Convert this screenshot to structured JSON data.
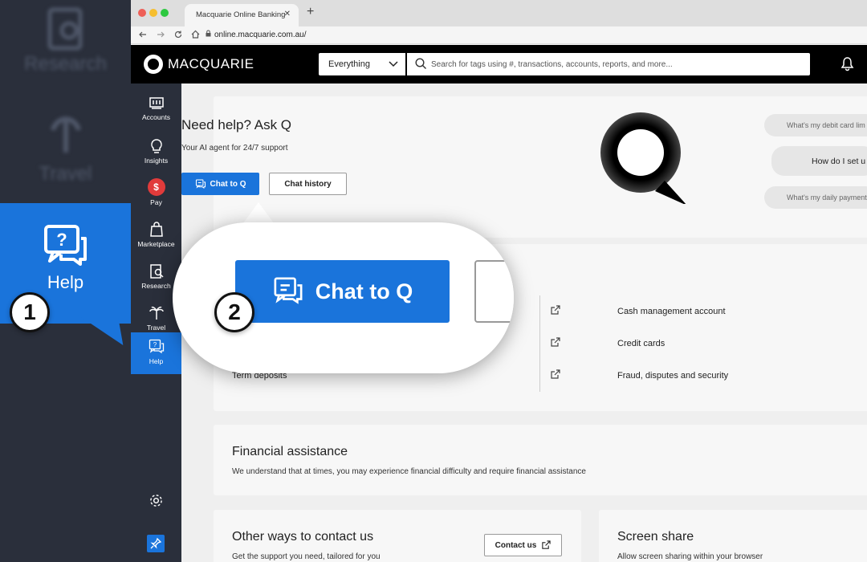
{
  "zoom": {
    "ghost_research": "Research",
    "ghost_travel": "Travel",
    "help_label": "Help",
    "step1": "1",
    "step2": "2",
    "chat_label": "Chat to Q"
  },
  "browser": {
    "tab_title": "Macquarie Online Banking",
    "tab_close": "✕",
    "new_tab": "+",
    "url": "online.macquarie.com.au/"
  },
  "header": {
    "brand": "MACQUARIE",
    "scope": "Everything",
    "search_placeholder": "Search for tags using #, transactions, accounts, reports, and more..."
  },
  "sidebar": {
    "items": [
      {
        "label": "Accounts"
      },
      {
        "label": "Insights"
      },
      {
        "label": "Pay"
      },
      {
        "label": "Marketplace"
      },
      {
        "label": "Research"
      },
      {
        "label": "Travel"
      },
      {
        "label": "Help"
      }
    ],
    "pay_symbol": "$"
  },
  "ask": {
    "title": "Need help? Ask Q",
    "subtitle": "Your AI agent for 24/7 support",
    "chat_button": "Chat to Q",
    "history_button": "Chat history",
    "chips": [
      "What's my debit card lim",
      "How do I set u",
      "What's my daily payment"
    ]
  },
  "links": {
    "left": [
      "Term deposits"
    ],
    "right": [
      "Cash management account",
      "Credit cards",
      "Fraud, disputes and security"
    ]
  },
  "financial": {
    "title": "Financial assistance",
    "body": "We understand that at times, you may experience financial difficulty and require financial assistance"
  },
  "other_ways": {
    "title": "Other ways to contact us",
    "body": "Get the support you need, tailored for you",
    "contact_button": "Contact us"
  },
  "screen_share": {
    "title": "Screen share",
    "body": "Allow screen sharing within your browser"
  },
  "colors": {
    "accent": "#1a74db",
    "sidebar": "#2a2f3b",
    "header": "#000000"
  }
}
